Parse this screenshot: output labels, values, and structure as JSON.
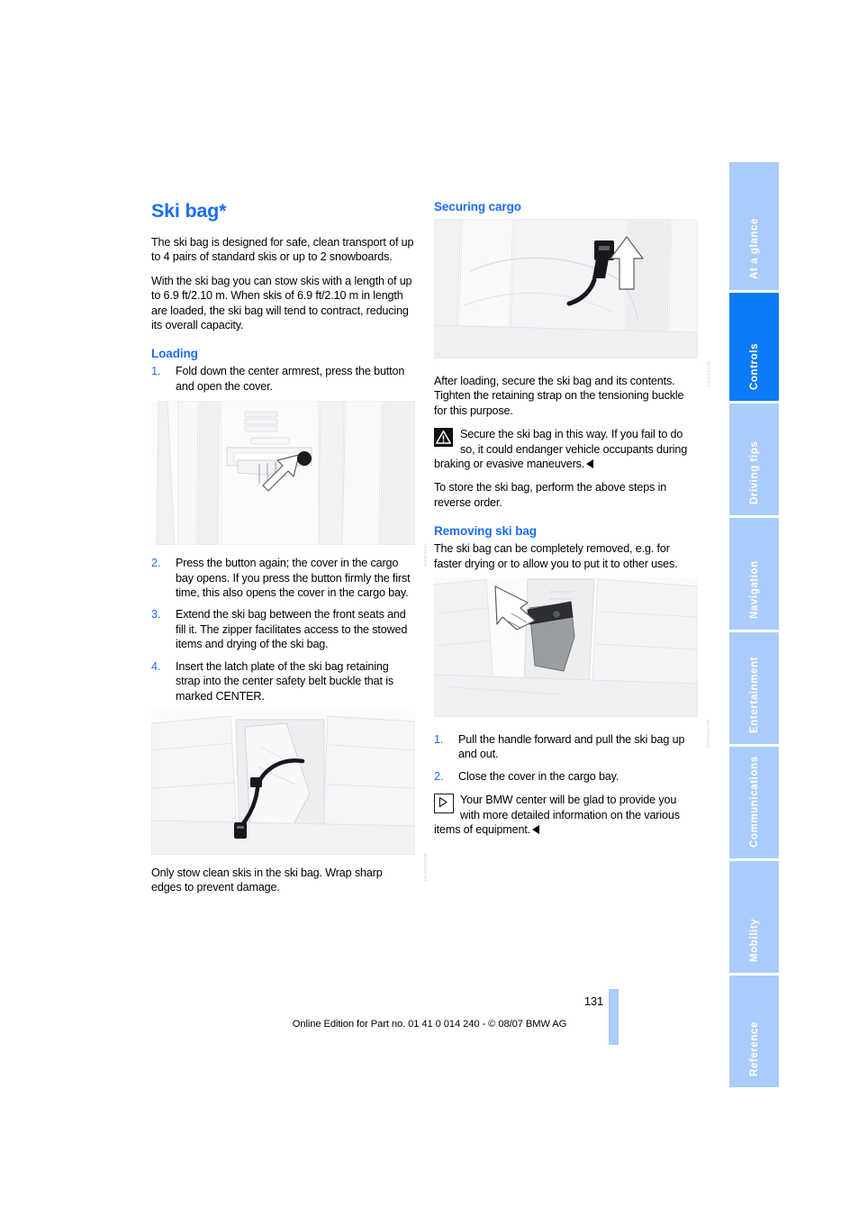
{
  "document": {
    "page_number": "131",
    "footer_text": "Online Edition for Part no. 01 41 0 014 240 - © 08/07 BMW AG"
  },
  "colors": {
    "accent_blue": "#1a6ef5",
    "tab_active": "#0d7bf7",
    "tab_inactive": "#aaccfa"
  },
  "left_column": {
    "title": "Ski bag*",
    "intro_1": "The ski bag is designed for safe, clean transport of up to 4 pairs of standard skis or up to 2 snowboards.",
    "intro_2": "With the ski bag you can stow skis with a length of up to 6.9 ft/2.10 m. When skis of 6.9 ft/2.10 m in length are loaded, the ski bag will tend to contract, reducing its overall capacity.",
    "loading_heading": "Loading",
    "steps": [
      {
        "num": "1.",
        "text": "Fold down the center armrest, press the button and open the cover."
      },
      {
        "num": "2.",
        "text": "Press the button again; the cover in the cargo bay opens. If you press the button firmly the first time, this also opens the cover in the cargo bay."
      },
      {
        "num": "3.",
        "text": "Extend the ski bag between the front seats and fill it. The zipper facilitates access to the stowed items and drying of the ski bag."
      },
      {
        "num": "4.",
        "text": "Insert the latch plate of the ski bag retaining strap into the center safety belt buckle that is marked CENTER."
      }
    ],
    "closing": "Only stow clean skis in the ski bag. Wrap sharp edges to prevent damage.",
    "figure_1": {
      "name": "armrest-button-illustration",
      "code": "KNJFOE3A"
    },
    "figure_2": {
      "name": "ski-bag-strap-illustration",
      "code": "KNJFOE27AB"
    }
  },
  "right_column": {
    "securing_heading": "Securing cargo",
    "securing_text": "After loading, secure the ski bag and its contents. Tighten the retaining strap on the tensioning buckle for this purpose.",
    "warning_text": "Secure the ski bag in this way. If you fail to do so, it could endanger vehicle occupants during braking or evasive maneuvers.",
    "store_text": "To store the ski bag, perform the above steps in reverse order.",
    "removing_heading": "Removing ski bag",
    "removing_text": "The ski bag can be completely removed, e.g. for faster drying or to allow you to put it to other uses.",
    "steps": [
      {
        "num": "1.",
        "text": "Pull the handle forward and pull the ski bag up and out."
      },
      {
        "num": "2.",
        "text": "Close the cover in the cargo bay."
      }
    ],
    "note_text": "Your BMW center will be glad to provide you with more detailed information on the various items of equipment.",
    "figure_1": {
      "name": "tensioning-buckle-illustration",
      "code": "KNJFOE3AB"
    },
    "figure_2": {
      "name": "ski-bag-removal-illustration",
      "code": "KNJFOE37AB"
    }
  },
  "sidebar": {
    "tabs": [
      {
        "label": "At a glance",
        "active": false
      },
      {
        "label": "Controls",
        "active": true
      },
      {
        "label": "Driving tips",
        "active": false
      },
      {
        "label": "Navigation",
        "active": false
      },
      {
        "label": "Entertainment",
        "active": false
      },
      {
        "label": "Communications",
        "active": false
      },
      {
        "label": "Mobility",
        "active": false
      },
      {
        "label": "Reference",
        "active": false
      }
    ]
  }
}
